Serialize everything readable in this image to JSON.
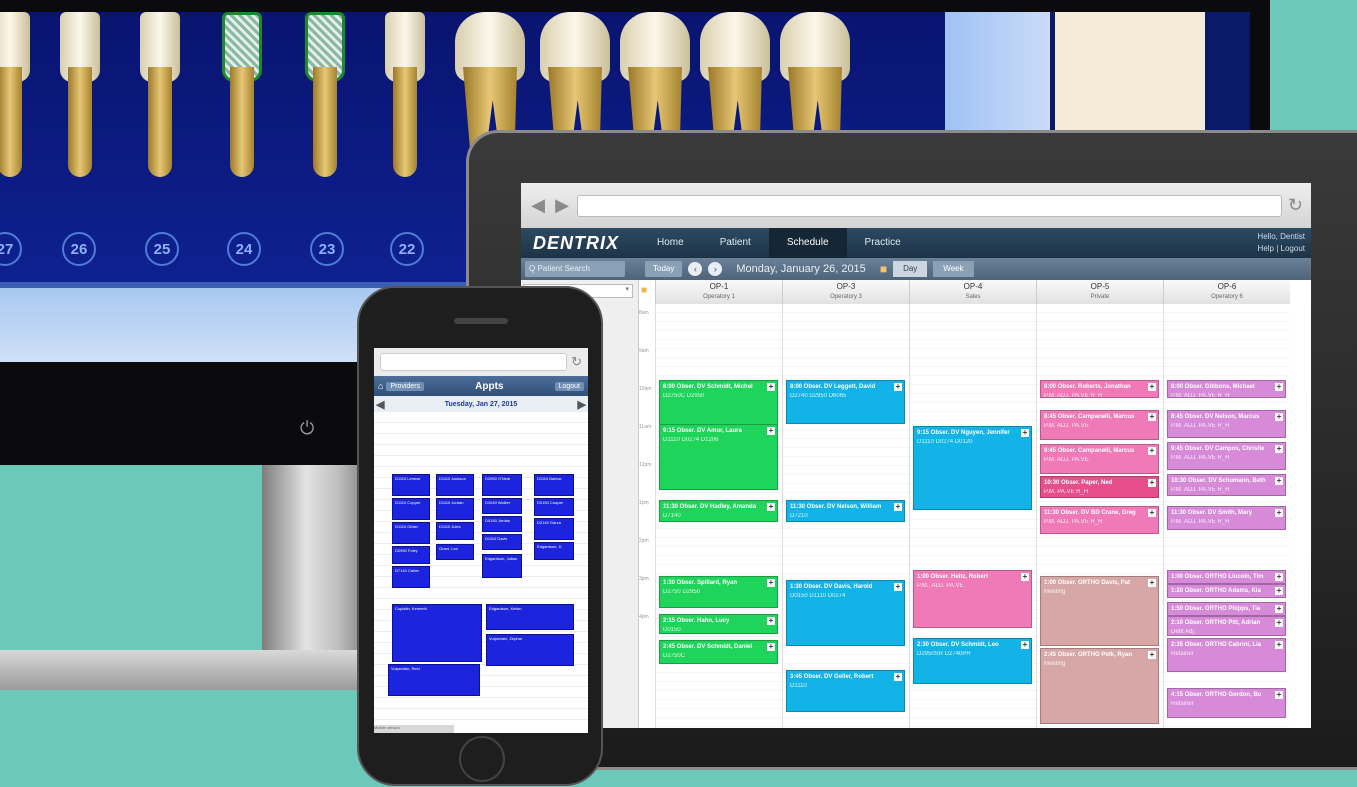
{
  "monitor": {
    "tooth_numbers": [
      "27",
      "26",
      "25",
      "24",
      "23",
      "22"
    ],
    "power_icon": "power-icon"
  },
  "tablet": {
    "browser": {
      "back_icon": "◀",
      "forward_icon": "▶",
      "refresh_icon": "↻"
    },
    "app": {
      "logo": "DENTRIX",
      "nav_tabs": [
        "Home",
        "Patient",
        "Schedule",
        "Practice"
      ],
      "active_tab": "Schedule",
      "user_links_1": "Hello, Dentist",
      "user_links_2": "Help | Logout"
    },
    "toolbar": {
      "search_placeholder": "Q Patient Search",
      "today_label": "Today",
      "prev_icon": "‹",
      "next_icon": "›",
      "date": "Monday, January 26, 2015",
      "view_day": "Day",
      "view_week": "Week"
    },
    "schedule": {
      "operatories": [
        {
          "name": "OP-1",
          "sub": "Operatory 1"
        },
        {
          "name": "OP-3",
          "sub": "Operatory 3"
        },
        {
          "name": "OP-4",
          "sub": "Sales"
        },
        {
          "name": "OP-5",
          "sub": "Private"
        },
        {
          "name": "OP-6",
          "sub": "Operatory 6"
        }
      ],
      "time_labels": [
        "8am",
        "9am",
        "10am",
        "11am",
        "12pm",
        "1pm",
        "2pm",
        "3pm",
        "4pm"
      ],
      "appointments": [
        {
          "op": 0,
          "color": "#1fd45a",
          "title": "8:00 Obser. DV Schmidt, Michel",
          "sub": "D2750C D2950"
        },
        {
          "op": 0,
          "color": "#1fd45a",
          "title": "9:15 Obser. DV Amur, Laura",
          "sub": "D1110 D0274 D1206"
        },
        {
          "op": 0,
          "color": "#1fd45a",
          "title": "11:30 Obser. DV Hadley, Amanda",
          "sub": "D7140"
        },
        {
          "op": 0,
          "color": "#1fd45a",
          "title": "1:30 Obser. Spillard, Ryan",
          "sub": "D2750 D2950"
        },
        {
          "op": 0,
          "color": "#1fd45a",
          "title": "2:15 Obser. Hahn, Lucy",
          "sub": "D0150"
        },
        {
          "op": 0,
          "color": "#1fd45a",
          "title": "2:45 Obser. DV Schmidt, Daniel",
          "sub": "D2750C"
        },
        {
          "op": 1,
          "color": "#12b4e8",
          "title": "8:00 Obser. DV Leggett, David",
          "sub": "D2740 D2950 D6065"
        },
        {
          "op": 1,
          "color": "#12b4e8",
          "title": "11:30 Obser. DV Nelson, William",
          "sub": "D7210"
        },
        {
          "op": 1,
          "color": "#12b4e8",
          "title": "1:30 Obser. DV Davis, Harold",
          "sub": "D0150 D1110 D0274"
        },
        {
          "op": 1,
          "color": "#12b4e8",
          "title": "3:45 Obser. DV Geller, Robert",
          "sub": "D1110"
        },
        {
          "op": 2,
          "color": "#12b4e8",
          "title": "9:15 Obser. DV Nguyen, Jennifer",
          "sub": "D1110 D0274 D0120"
        },
        {
          "op": 2,
          "color": "#f07ab8",
          "title": "1:00 Obser. Heitz, Robert",
          "sub": "P.M., ADJ.  PA.VE"
        },
        {
          "op": 2,
          "color": "#12b4e8",
          "title": "2:30 Obser. DV Schmidt, Leo",
          "sub": "D2950SR D2740PR"
        },
        {
          "op": 3,
          "color": "#f07ab8",
          "title": "8:00 Obser. Roberts, Jonathan",
          "sub": "P.M.  ADJ.  PA.VE  R_H"
        },
        {
          "op": 3,
          "color": "#f07ab8",
          "title": "8:45 Obser. Campanelli, Marcus",
          "sub": "P.M.  ADJ.  PA.VE"
        },
        {
          "op": 3,
          "color": "#f07ab8",
          "title": "9:45 Obser. Campanelli, Marcus",
          "sub": "P.M.  ADJ.  PA.VE"
        },
        {
          "op": 3,
          "color": "#e64f8c",
          "title": "10:30 Obser. Paper, Ned",
          "sub": "P.M.  PA.VE  R_H"
        },
        {
          "op": 3,
          "color": "#f07ab8",
          "title": "11:30 Obser. DV BD Crane, Greg",
          "sub": "P.M.  ADJ.  PA.VE  R_H"
        },
        {
          "op": 3,
          "color": "#d7a7a7",
          "title": "1:00 Obser. ORTHO Davis, Pat",
          "sub": "Meeting"
        },
        {
          "op": 3,
          "color": "#d7a7a7",
          "title": "2:45 Obser. ORTHO Polk, Ryan",
          "sub": "Meeting"
        },
        {
          "op": 4,
          "color": "#d68ad8",
          "title": "8:00 Obser. Gibbons, Michael",
          "sub": "P.M.  ADJ.  PA.VE  R_H"
        },
        {
          "op": 4,
          "color": "#d68ad8",
          "title": "8:45 Obser. DV Nelson, Marcus",
          "sub": "P.M.  ADJ.  PA.VE  R_H"
        },
        {
          "op": 4,
          "color": "#d68ad8",
          "title": "9:45 Obser. DV Campos, Christie",
          "sub": "P.M.  ADJ.  PA.VE  R_H"
        },
        {
          "op": 4,
          "color": "#d68ad8",
          "title": "10:30 Obser. DV Schumann, Beth",
          "sub": "P.M.  ADJ.  PA.VE  R_H"
        },
        {
          "op": 4,
          "color": "#d68ad8",
          "title": "11:30 Obser. DV Smith, Mary",
          "sub": "P.M.  ADJ.  PA.VE  R_H"
        },
        {
          "op": 4,
          "color": "#d68ad8",
          "title": "1:00 Obser. ORTHO Lincoln, Tim",
          "sub": ""
        },
        {
          "op": 4,
          "color": "#d68ad8",
          "title": "1:20 Obser. ORTHO Adams, Kia",
          "sub": ""
        },
        {
          "op": 4,
          "color": "#d68ad8",
          "title": "1:50 Obser. ORTHO Phipps, Tia",
          "sub": ""
        },
        {
          "op": 4,
          "color": "#d68ad8",
          "title": "2:10 Obser. ORTHO Pitt, Adrian",
          "sub": "Debt Adj."
        },
        {
          "op": 4,
          "color": "#d68ad8",
          "title": "2:35 Obser. ORTHO Cabrini, Lia",
          "sub": "Retainer"
        },
        {
          "op": 4,
          "color": "#d68ad8",
          "title": "4:15 Obser. ORTHO Gordon, Bo",
          "sub": "Retainer"
        }
      ]
    }
  },
  "phone": {
    "refresh_icon": "↻",
    "home_icon": "⌂",
    "back_label": "Providers",
    "title": "Appts",
    "logout_label": "Logout",
    "date": "Tuesday, Jan 27, 2015",
    "prev_icon": "◀",
    "next_icon": "▶",
    "blocks": [
      "D1110 Lennax",
      "D1110 Jackson",
      "D2950 O'Neal",
      "D1110 Barlow",
      "D1110 Copper",
      "D1110 Jordan",
      "D1040 Walker",
      "D0150 Cooper",
      "D1110 Gilder",
      "D1110 Jules",
      "D0150 Jordan",
      "D2140 Garza",
      "D2950 Foley",
      "D1110 Davis",
      "D7140 Carter",
      "Edgardson, Julian",
      "Grant, Leo",
      "Edgardson, D",
      "Cuplatin, Kenneth",
      "Edgardson, Kelvin",
      "Vulpeclain, Zephar",
      "Vulpeclain, Reid"
    ],
    "footer": "Mobile version"
  }
}
